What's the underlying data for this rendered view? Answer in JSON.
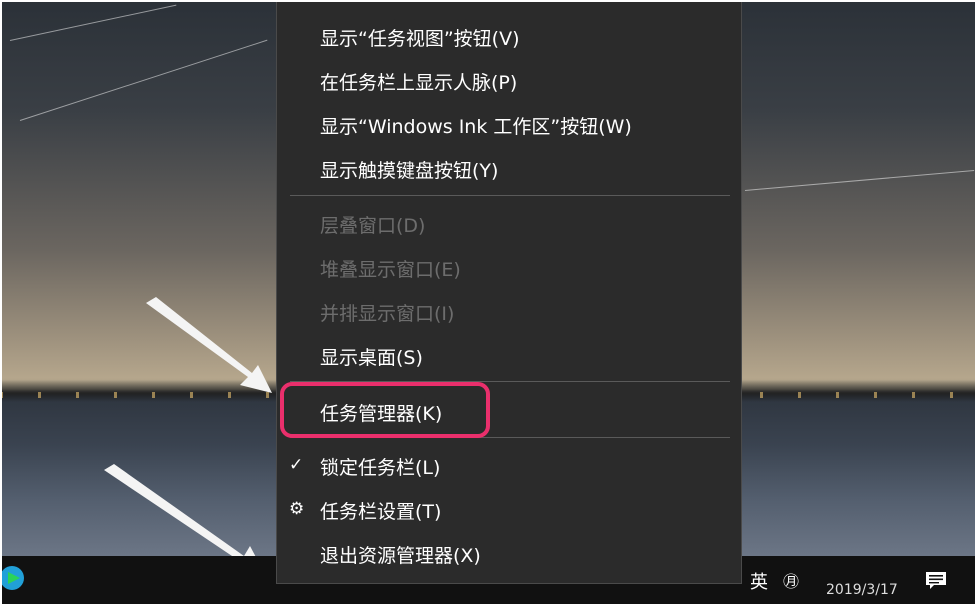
{
  "menu": {
    "items": [
      {
        "label": "显示“任务视图”按钮(V)",
        "enabled": true
      },
      {
        "label": "在任务栏上显示人脉(P)",
        "enabled": true
      },
      {
        "label": "显示“Windows Ink 工作区”按钮(W)",
        "enabled": true
      },
      {
        "label": "显示触摸键盘按钮(Y)",
        "enabled": true
      },
      {
        "label": "层叠窗口(D)",
        "enabled": false
      },
      {
        "label": "堆叠显示窗口(E)",
        "enabled": false
      },
      {
        "label": "并排显示窗口(I)",
        "enabled": false
      },
      {
        "label": "显示桌面(S)",
        "enabled": true
      },
      {
        "label": "任务管理器(K)",
        "enabled": true,
        "highlighted": true
      },
      {
        "label": "锁定任务栏(L)",
        "enabled": true,
        "checked": true
      },
      {
        "label": "任务栏设置(T)",
        "enabled": true,
        "icon": "gear-icon"
      },
      {
        "label": "退出资源管理器(X)",
        "enabled": true
      }
    ]
  },
  "taskbar": {
    "ime_label": "英",
    "calendar_label": "㊊",
    "date": "2019/3/17",
    "notification_icon": "action-center-icon"
  },
  "colors": {
    "menu_bg": "#2b2b2b",
    "highlight": "#ea2f6c",
    "disabled_text": "#6d6d6d"
  }
}
